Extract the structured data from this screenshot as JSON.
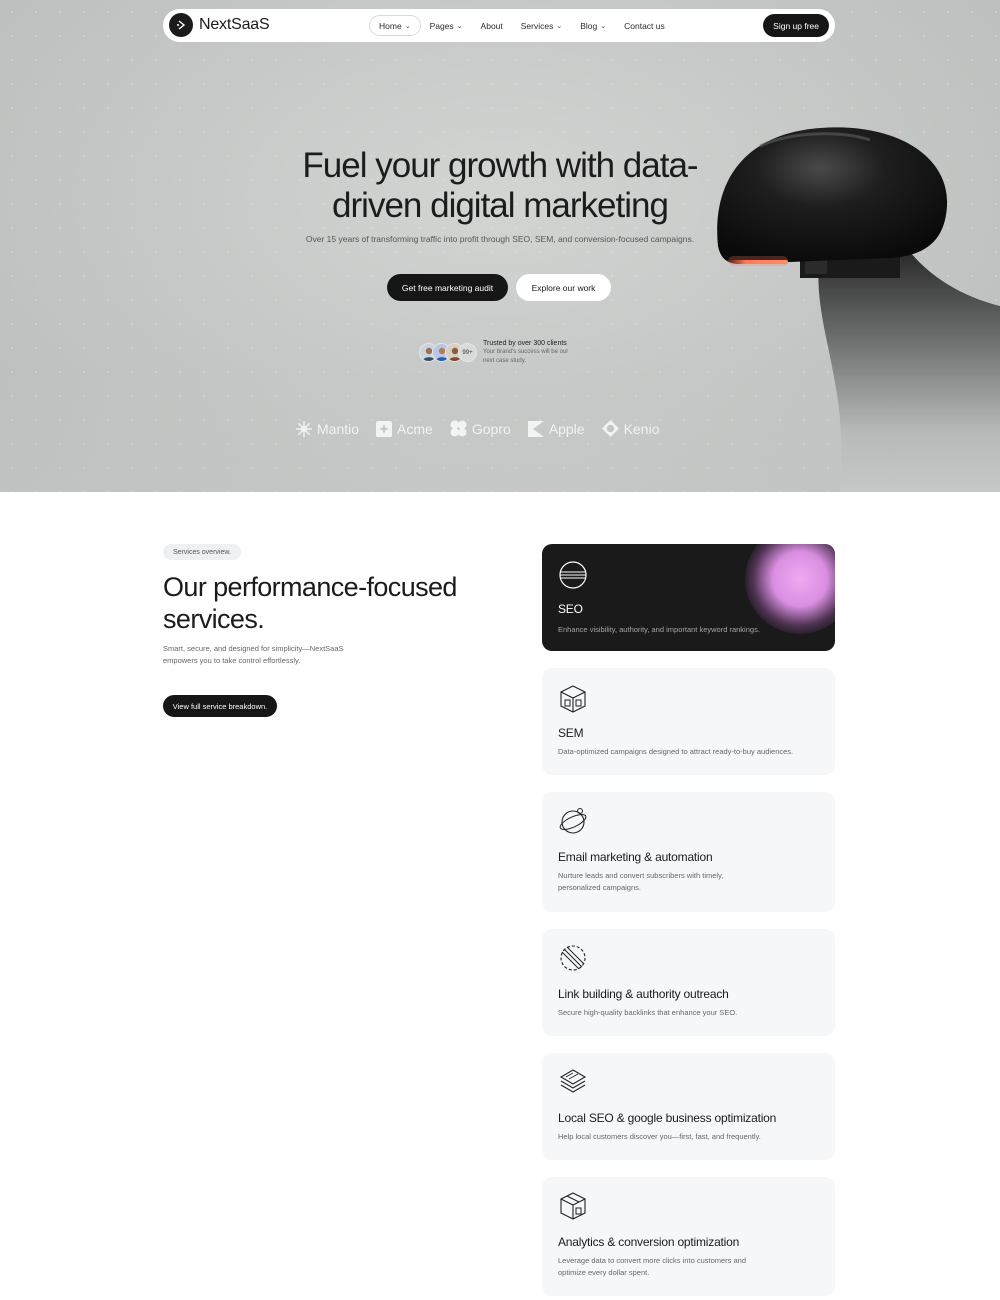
{
  "nav": {
    "brand_a": "Next",
    "brand_b": "SaaS",
    "items": [
      {
        "label": "Home",
        "dropdown": true,
        "active": true
      },
      {
        "label": "Pages",
        "dropdown": true
      },
      {
        "label": "About",
        "dropdown": false
      },
      {
        "label": "Services",
        "dropdown": true
      },
      {
        "label": "Blog",
        "dropdown": true
      },
      {
        "label": "Contact us",
        "dropdown": false
      }
    ],
    "signup": "Sign up free"
  },
  "hero": {
    "title_line1": "Fuel your growth with data-",
    "title_line2": "driven digital marketing",
    "subtitle": "Over 15 years of transforming traffic into profit through SEO, SEM, and conversion-focused campaigns.",
    "cta_primary": "Get free marketing audit",
    "cta_secondary": "Explore our work",
    "avatar_count": "99+",
    "trust_title": "Trusted by over 300 clients",
    "trust_desc": "Your brand's success will be our next case study.",
    "brands": [
      {
        "name": "Mantio",
        "icon": "sunburst-icon"
      },
      {
        "name": "Acme",
        "icon": "square-star-icon"
      },
      {
        "name": "Gopro",
        "icon": "clover-icon"
      },
      {
        "name": "Apple",
        "icon": "k-shape-icon"
      },
      {
        "name": "Kenio",
        "icon": "diamond-ring-icon"
      }
    ]
  },
  "services": {
    "tag": "Services overview.",
    "title_line1": "Our performance-focused",
    "title_line2": "services.",
    "description": "Smart, secure, and designed for simplicity—NextSaaS empowers you to take control effortlessly.",
    "cta": "View full service breakdown.",
    "cards": [
      {
        "title": "SEO",
        "desc": "Enhance visibility, authority, and important keyword rankings.",
        "icon": "sphere-icon"
      },
      {
        "title": "SEM",
        "desc": "Data-optimized campaigns designed to attract ready-to-buy audiences.",
        "icon": "cube-icon"
      },
      {
        "title": "Email marketing & automation",
        "desc": "Nurture leads and convert subscribers with timely, personalized campaigns.",
        "icon": "orbit-icon"
      },
      {
        "title": "Link building & authority outreach",
        "desc": "Secure high-quality backlinks that enhance your SEO.",
        "icon": "striped-circle-icon"
      },
      {
        "title": "Local SEO & google business optimization",
        "desc": "Help local customers discover you—first, fast, and frequently.",
        "icon": "layers-icon"
      },
      {
        "title": "Analytics & conversion optimization",
        "desc": "Leverage data to convert more clicks into customers and optimize every dollar spent.",
        "icon": "box-icon"
      }
    ]
  }
}
